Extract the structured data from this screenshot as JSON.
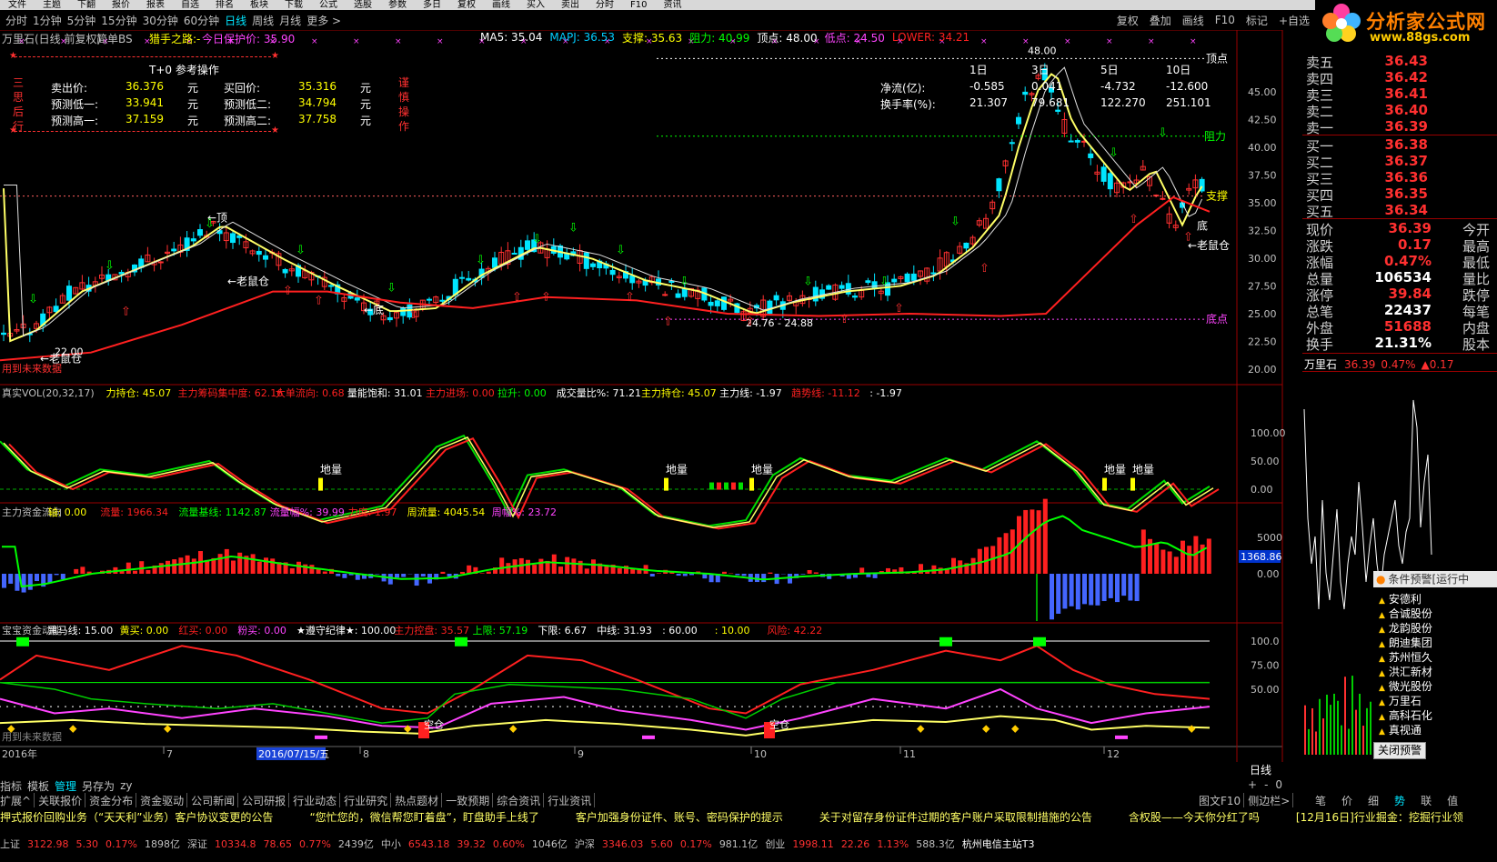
{
  "menubar": [
    "文件",
    "主题",
    "下翻",
    "报价",
    "报表",
    "自选",
    "排名",
    "板块",
    "下载",
    "公式",
    "选股",
    "参数",
    "多日",
    "复权",
    "画线",
    "买入",
    "卖出",
    "分时",
    "F10",
    "资讯"
  ],
  "period_tabs": [
    "分时",
    "1分钟",
    "5分钟",
    "15分钟",
    "30分钟",
    "60分钟",
    "日线",
    "周线",
    "月线",
    "更多 >"
  ],
  "active_period": "日线",
  "right_tools": [
    "复权",
    "叠加",
    "画线",
    "F10",
    "标记",
    "+自选"
  ],
  "logo": {
    "cn": "分析家公式网",
    "url": "www.88gs.com"
  },
  "title": {
    "stock": "万里石(日线 前复权)",
    "mode": "简单BS",
    "hunter": "猎手之路:-",
    "today_hold": "今日保护价: 35.90"
  },
  "ind_main": [
    {
      "t": "MA5: 35.04",
      "c": "#ffffff"
    },
    {
      "t": "MAPJ: 36.53",
      "c": "#00ccff"
    },
    {
      "t": "支撑: 35.63",
      "c": "#ffff00"
    },
    {
      "t": "阻力: 40.99",
      "c": "#00ff00"
    },
    {
      "t": "顶点: 48.00",
      "c": "#ffffff"
    },
    {
      "t": "低点: 24.50",
      "c": "#ff44ff"
    },
    {
      "t": "LOWER: 34.21",
      "c": "#ff2020"
    }
  ],
  "t0": {
    "title": "T+0 参考操作",
    "side": [
      "三",
      "思",
      "后",
      "行"
    ],
    "side2": [
      "谨",
      "慎",
      "操",
      "作"
    ],
    "rows": [
      {
        "k1": "卖出价:",
        "v1": "36.376",
        "u1": "元",
        "k2": "买回价:",
        "v2": "35.316",
        "u2": "元"
      },
      {
        "k1": "预测低一:",
        "v1": "33.941",
        "u1": "元",
        "k2": "预测低二:",
        "v2": "34.794",
        "u2": "元"
      },
      {
        "k1": "预测高一:",
        "v1": "37.159",
        "u1": "元",
        "k2": "预测高二:",
        "v2": "37.758",
        "u2": "元"
      }
    ]
  },
  "flow_table": {
    "headers": [
      "1日",
      "3日",
      "5日",
      "10日"
    ],
    "rows": [
      {
        "k": "净流(亿):",
        "v": [
          "-0.585",
          "0.041",
          "-4.732",
          "-12.600"
        ]
      },
      {
        "k": "换手率(%):",
        "v": [
          "21.307",
          "79.681",
          "122.270",
          "251.101"
        ]
      }
    ]
  },
  "main_labels": {
    "top": "顶点",
    "resist": "阻力",
    "support": "支撑",
    "bottom": "底点",
    "peak": "48.00",
    "low_range": "24.76 - 24.88",
    "low_val": "22.00",
    "top_mark": "←顶",
    "low_mark": "←底",
    "old_mouse": "←老鼠仓",
    "note": "用到未来数据",
    "bottom2": "底"
  },
  "price_axis": [
    "45.00",
    "42.50",
    "40.00",
    "37.50",
    "35.00",
    "32.50",
    "30.00",
    "27.50",
    "25.00",
    "22.50",
    "20.00"
  ],
  "vol_header": [
    {
      "t": "真实VOL(20,32,17)",
      "c": "#c0c0c0"
    },
    {
      "t": "力持仓: 45.07",
      "c": "#ffff00"
    },
    {
      "t": "主力筹码集中度: 62.16",
      "c": "#ff2020"
    },
    {
      "t": "大单流向: 0.68",
      "c": "#ff2020"
    },
    {
      "t": "量能饱和: 31.01",
      "c": "#ffffff"
    },
    {
      "t": "主力进场: 0.00",
      "c": "#ff2020"
    },
    {
      "t": "拉升: 0.00",
      "c": "#00ff00"
    },
    {
      "t": "成交量比%: 71.21",
      "c": "#ffffff"
    },
    {
      "t": "主力持仓: 45.07",
      "c": "#ffff00"
    },
    {
      "t": "主力线: -1.97",
      "c": "#ffffff"
    },
    {
      "t": "趋势线: -11.12",
      "c": "#ff2020"
    },
    {
      "t": ": -1.97",
      "c": "#ffffff"
    }
  ],
  "vol_axis": [
    "100.00",
    "50.00",
    "0.00"
  ],
  "vol_marks": {
    "dl": "地量"
  },
  "flow_header": [
    {
      "t": "主力资金流向",
      "c": "#c0c0c0"
    },
    {
      "t": "轴: 0.00",
      "c": "#ffff00"
    },
    {
      "t": "流量: 1966.34",
      "c": "#ff2020"
    },
    {
      "t": "流量基线: 1142.87",
      "c": "#00ff00"
    },
    {
      "t": "流量幅%: 39.99",
      "c": "#ff44ff"
    },
    {
      "t": "力度: 1.97",
      "c": "#ff2020"
    },
    {
      "t": "周流量: 4045.54",
      "c": "#ffff00"
    },
    {
      "t": "周幅%: 23.72",
      "c": "#ff44ff"
    }
  ],
  "flow_axis": [
    "5000",
    "0.00"
  ],
  "flow_box": "1368.86",
  "bb_header": [
    {
      "t": "宝宝资金动能",
      "c": "#c0c0c0"
    },
    {
      "t": "黑马线: 15.00",
      "c": "#ffffff"
    },
    {
      "t": "黄买: 0.00",
      "c": "#ffff00"
    },
    {
      "t": "红买: 0.00",
      "c": "#ff2020"
    },
    {
      "t": "粉买: 0.00",
      "c": "#ff44ff"
    },
    {
      "t": "★遵守纪律★: 100.00",
      "c": "#ffffff"
    },
    {
      "t": "主力控盘: 35.57",
      "c": "#ff2020"
    },
    {
      "t": "上限: 57.19",
      "c": "#00ff00"
    },
    {
      "t": "下限: 6.67",
      "c": "#ffffff"
    },
    {
      "t": "中线: 31.93",
      "c": "#ffffff"
    },
    {
      "t": ": 60.00",
      "c": "#ffffff"
    },
    {
      "t": ": 10.00",
      "c": "#ffff00"
    },
    {
      "t": "风险: 42.22",
      "c": "#ff2020"
    }
  ],
  "bb_axis": [
    "100.0",
    "75.00",
    "50.00"
  ],
  "bb_marks": {
    "empty": "空仓",
    "note": "用到未来数据"
  },
  "date_axis": {
    "year": "2016年",
    "months": [
      "7",
      "8",
      "9",
      "10",
      "11",
      "12"
    ],
    "cursor_date": "2016/07/15/五"
  },
  "order_book": {
    "sell": [
      {
        "k": "卖五",
        "v": "36.43"
      },
      {
        "k": "卖四",
        "v": "36.42"
      },
      {
        "k": "卖三",
        "v": "36.41"
      },
      {
        "k": "卖二",
        "v": "36.40"
      },
      {
        "k": "卖一",
        "v": "36.39"
      }
    ],
    "buy": [
      {
        "k": "买一",
        "v": "36.38"
      },
      {
        "k": "买二",
        "v": "36.37"
      },
      {
        "k": "买三",
        "v": "36.36"
      },
      {
        "k": "买四",
        "v": "36.35"
      },
      {
        "k": "买五",
        "v": "36.34"
      }
    ]
  },
  "stats": [
    {
      "k": "现价",
      "v": "36.39",
      "c": "#ff3030",
      "k2": "今开"
    },
    {
      "k": "涨跌",
      "v": "0.17",
      "c": "#ff3030",
      "k2": "最高"
    },
    {
      "k": "涨幅",
      "v": "0.47%",
      "c": "#ff3030",
      "k2": "最低"
    },
    {
      "k": "总量",
      "v": "106534",
      "c": "#ffffff",
      "k2": "量比"
    },
    {
      "k": "涨停",
      "v": "39.84",
      "c": "#ff3030",
      "k2": "跌停"
    },
    {
      "k": "总笔",
      "v": "22437",
      "c": "#ffffff",
      "k2": "每笔"
    },
    {
      "k": "外盘",
      "v": "51688",
      "c": "#ff3030",
      "k2": "内盘"
    },
    {
      "k": "换手",
      "v": "21.31%",
      "c": "#ffffff",
      "k2": "股本"
    }
  ],
  "mini_quote": {
    "name": "万里石",
    "price": "36.39",
    "pct": "0.47%",
    "chg": "▲0.17"
  },
  "alert": {
    "title": "条件预警[运行中",
    "items": [
      "安德利",
      "合诚股份",
      "龙韵股份",
      "朗迪集团",
      "苏州恒久",
      "洪汇新材",
      "微光股份",
      "万里石",
      "高科石化",
      "真视通"
    ],
    "close": "关闭预警"
  },
  "bottom_tabs": [
    "指标",
    "模板",
    "管理",
    "另存为",
    "zy"
  ],
  "bottom_right": [
    "+",
    "-",
    "0"
  ],
  "day_label": "日线",
  "tabs2": [
    "扩展^",
    "关联报价",
    "资金分布",
    "资金驱动",
    "公司新闻",
    "公司研报",
    "行业动态",
    "行业研究",
    "热点题材",
    "一致预期",
    "综合资讯",
    "行业资讯"
  ],
  "tabs2_right": [
    "图文F10",
    "侧边栏>"
  ],
  "tabs3": [
    "笔",
    "价",
    "细",
    "势",
    "联",
    "值"
  ],
  "ticker": [
    "押式报价回购业务（“天天利”业务）客户协议变更的公告",
    "“您忙您的，微信帮您盯着盘”，盯盘助手上线了",
    "客户加强身份证件、账号、密码保护的提示",
    "关于对留存身份证件过期的客户账户采取限制措施的公告",
    "含权股——今天你分红了吗",
    "[12月16日]行业掘金：挖掘行业领"
  ],
  "status": [
    {
      "t": "上证",
      "c": "#c0c0c0"
    },
    {
      "t": "3122.98",
      "c": "#ff3030"
    },
    {
      "t": "5.30",
      "c": "#ff3030"
    },
    {
      "t": "0.17%",
      "c": "#ff3030"
    },
    {
      "t": "1898亿",
      "c": "#c0c0c0"
    },
    {
      "t": "深证",
      "c": "#c0c0c0"
    },
    {
      "t": "10334.8",
      "c": "#ff3030"
    },
    {
      "t": "78.65",
      "c": "#ff3030"
    },
    {
      "t": "0.77%",
      "c": "#ff3030"
    },
    {
      "t": "2439亿",
      "c": "#c0c0c0"
    },
    {
      "t": "中小",
      "c": "#c0c0c0"
    },
    {
      "t": "6543.18",
      "c": "#ff3030"
    },
    {
      "t": "39.32",
      "c": "#ff3030"
    },
    {
      "t": "0.60%",
      "c": "#ff3030"
    },
    {
      "t": "1046亿",
      "c": "#c0c0c0"
    },
    {
      "t": "沪深",
      "c": "#c0c0c0"
    },
    {
      "t": "3346.03",
      "c": "#ff3030"
    },
    {
      "t": "5.60",
      "c": "#ff3030"
    },
    {
      "t": "0.17%",
      "c": "#ff3030"
    },
    {
      "t": "981.1亿",
      "c": "#c0c0c0"
    },
    {
      "t": "创业",
      "c": "#c0c0c0"
    },
    {
      "t": "1998.11",
      "c": "#ff3030"
    },
    {
      "t": "22.26",
      "c": "#ff3030"
    },
    {
      "t": "1.13%",
      "c": "#ff3030"
    },
    {
      "t": "588.3亿",
      "c": "#c0c0c0"
    },
    {
      "t": "杭州电信主站T3",
      "c": "#ffffff"
    }
  ]
}
